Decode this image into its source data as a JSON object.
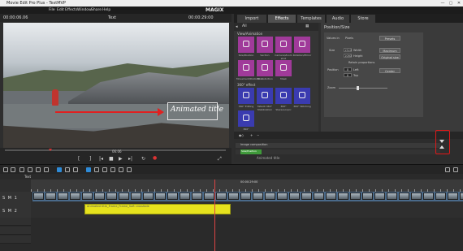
{
  "window": {
    "title": "Movie Edit Pro Plus - TestMVP",
    "controls": [
      "—",
      "▢",
      "✕"
    ]
  },
  "menu": {
    "items": [
      "File",
      "Edit",
      "Effects",
      "Window",
      "Share",
      "Help"
    ],
    "brand": "MAGIX"
  },
  "preview": {
    "timecode_left": "00:00:06.06",
    "dropdown_label": "Text",
    "timecode_right": "00:00:29:00",
    "overlay_text": "Animated title",
    "scrub_time": "06:06"
  },
  "media_tabs": {
    "tabs": [
      "Import",
      "Effects",
      "Templates",
      "Audio",
      "Store"
    ],
    "active": "Effects"
  },
  "effects_pool": {
    "filter_label": "All",
    "section_view_animation": "View/Animation",
    "section_360": "360° effect",
    "tiles_row1": [
      "Size/Position",
      "Section",
      "Camera/Zoom shot",
      "Rotation/Mirror"
    ],
    "tiles_row2": [
      "Movement/Distortion",
      "3D distortion",
      "Mask"
    ],
    "tiles_row3": [
      "360° Editing",
      "MAGIX 360° Stabilization",
      "360° Stereoscopic",
      "360° Stitching"
    ],
    "tiles_row4": [
      "360° Stabilization"
    ]
  },
  "position_panel": {
    "title": "Position/Size",
    "values_in_label": "Values in",
    "unit_option": "Pixels",
    "presets_button": "Presets",
    "size_label": "Size",
    "width_value": "1920",
    "height_value": "1080",
    "width_label": "Width",
    "height_label": "Height",
    "max_size_button": "Maximum size",
    "original_size_button": "Original size",
    "retain_proportions": "Retain proportions",
    "position_label": "Position",
    "left_value": "0",
    "top_value": "0",
    "left_label": "Left",
    "top_label": "Top",
    "center_button": "Center",
    "zoom_label": "Zoom"
  },
  "keyframes": {
    "track_label": "Image composition",
    "sub_label": "Size/Position",
    "movie_title": "Animated title"
  },
  "timeline": {
    "tab_label": "Text",
    "center_time": "00:00:29:00",
    "track1_label": "S M 1",
    "track2_label": "S M 2",
    "title_clip_label": "Animated title_Frame_Frame_Soft crossfade"
  },
  "colors": {
    "accent": "#2e8bd8",
    "effect_tile": "#a03a9a",
    "effect_tile_360": "#3a3bb0",
    "title_clip": "#e6e21e",
    "highlight_box": "#e01818"
  }
}
